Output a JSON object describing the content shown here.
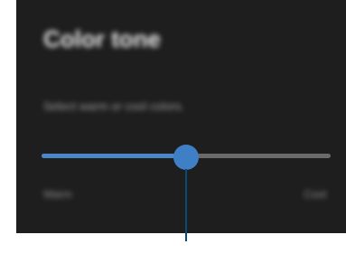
{
  "settings_panel": {
    "title": "Color tone",
    "description": "Select warm or cool colors.",
    "color_tone_slider": {
      "value_fraction": 0.5,
      "min_label": "Warm",
      "max_label": "Cool"
    }
  },
  "colors": {
    "panel_background": "#1e1e1e",
    "slider_active": "#4a86c8",
    "slider_inactive": "#6a6a6a",
    "callout_line": "#0a4a7a"
  }
}
